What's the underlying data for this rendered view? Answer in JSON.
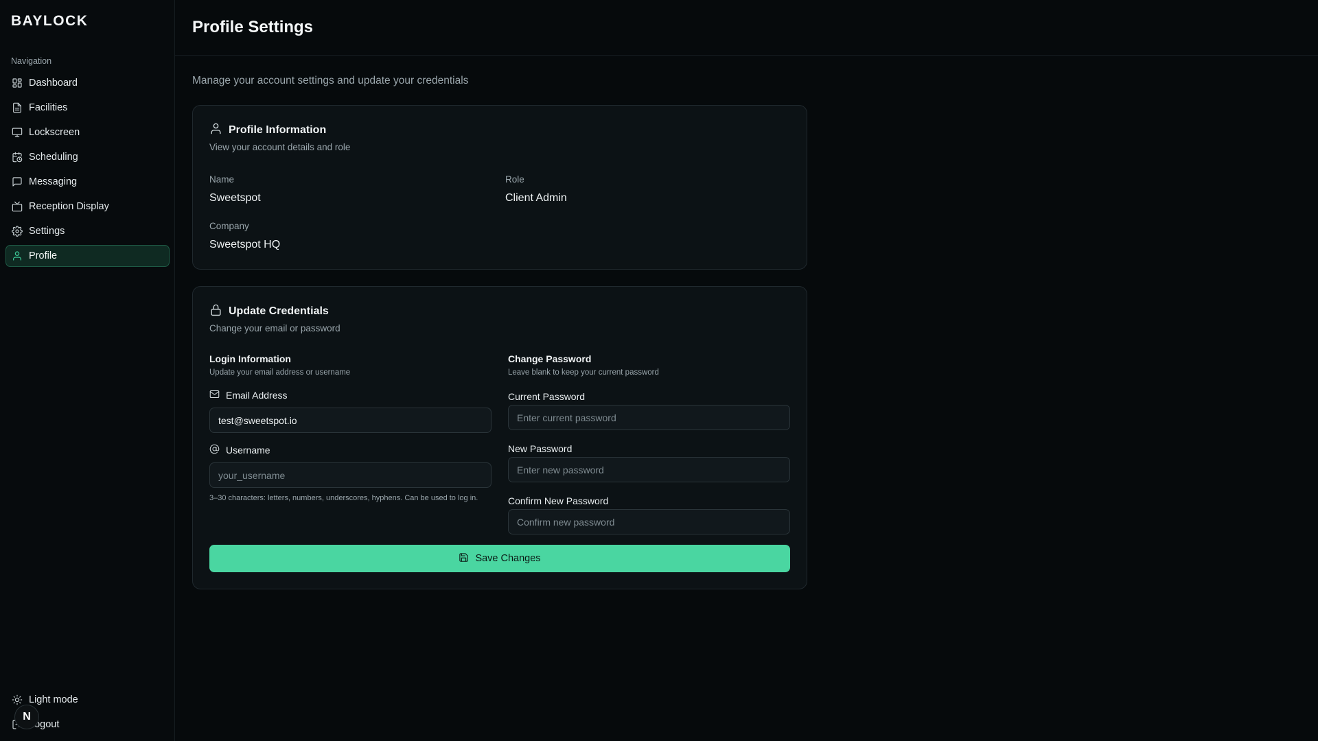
{
  "brand": {
    "name": "BAYLOCK"
  },
  "sidebar": {
    "section_label": "Navigation",
    "items": [
      {
        "label": "Dashboard",
        "icon": "grid-icon"
      },
      {
        "label": "Facilities",
        "icon": "document-icon"
      },
      {
        "label": "Lockscreen",
        "icon": "monitor-icon"
      },
      {
        "label": "Scheduling",
        "icon": "calendar-clock-icon"
      },
      {
        "label": "Messaging",
        "icon": "message-icon"
      },
      {
        "label": "Reception Display",
        "icon": "tv-icon"
      },
      {
        "label": "Settings",
        "icon": "gear-icon"
      },
      {
        "label": "Profile",
        "icon": "user-icon",
        "active": true
      }
    ],
    "bottom": {
      "theme_toggle": "Light mode",
      "logout": "Logout"
    },
    "avatar_letter": "N"
  },
  "header": {
    "title": "Profile Settings"
  },
  "page": {
    "subtitle": "Manage your account settings and update your credentials"
  },
  "profile_card": {
    "title": "Profile Information",
    "description": "View your account details and role",
    "name_label": "Name",
    "name_value": "Sweetspot",
    "role_label": "Role",
    "role_value": "Client Admin",
    "company_label": "Company",
    "company_value": "Sweetspot HQ"
  },
  "credentials_card": {
    "title": "Update Credentials",
    "description": "Change your email or password",
    "login": {
      "title": "Login Information",
      "description": "Update your email address or username",
      "email_label": "Email Address",
      "email_value": "test@sweetspot.io",
      "username_label": "Username",
      "username_placeholder": "your_username",
      "username_hint": "3–30 characters: letters, numbers, underscores, hyphens. Can be used to log in."
    },
    "password": {
      "title": "Change Password",
      "description": "Leave blank to keep your current password",
      "current_label": "Current Password",
      "current_placeholder": "Enter current password",
      "new_label": "New Password",
      "new_placeholder": "Enter new password",
      "confirm_label": "Confirm New Password",
      "confirm_placeholder": "Confirm new password"
    },
    "save_label": "Save Changes"
  },
  "colors": {
    "accent": "#4ad6a1",
    "active_bg": "#0f2a22",
    "background": "#060a0c",
    "card": "#0c1215"
  }
}
